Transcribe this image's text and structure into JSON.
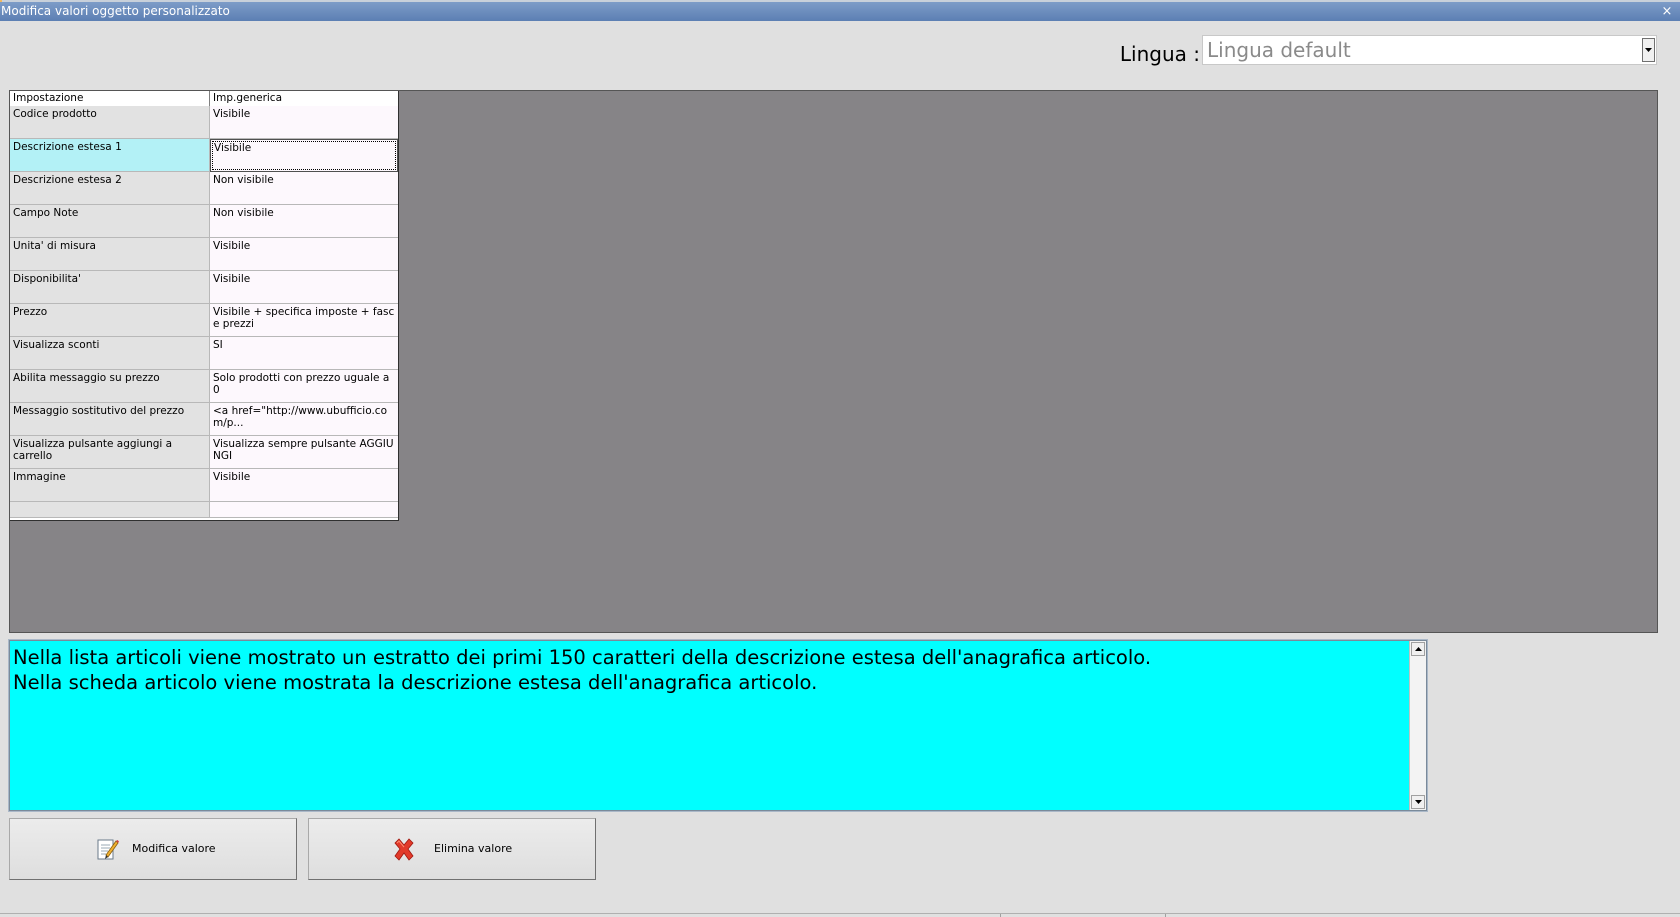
{
  "window": {
    "title": "Modifica valori oggetto personalizzato",
    "close_glyph": "×"
  },
  "language": {
    "label": "Lingua :",
    "selected": "Lingua default"
  },
  "grid": {
    "headers": [
      "Impostazione",
      "Imp.generica"
    ],
    "rows": [
      {
        "setting": "Codice prodotto",
        "value": "Visibile"
      },
      {
        "setting": "Descrizione estesa 1",
        "value": "Visibile"
      },
      {
        "setting": "Descrizione estesa 2",
        "value": "Non visibile"
      },
      {
        "setting": "Campo Note",
        "value": "Non visibile"
      },
      {
        "setting": "Unita' di misura",
        "value": "Visibile"
      },
      {
        "setting": "Disponibilita'",
        "value": "Visibile"
      },
      {
        "setting": "Prezzo",
        "value": "Visibile + specifica imposte + fasce prezzi"
      },
      {
        "setting": "Visualizza sconti",
        "value": "SI"
      },
      {
        "setting": "Abilita messaggio su prezzo",
        "value": "Solo prodotti con prezzo uguale a 0"
      },
      {
        "setting": "Messaggio sostitutivo del prezzo",
        "value": "<a href=\"http://www.ubufficio.com/p..."
      },
      {
        "setting": "Visualizza pulsante aggiungi a carrello",
        "value": "Visualizza sempre pulsante AGGIUNGI"
      },
      {
        "setting": "Immagine",
        "value": "Visibile"
      }
    ],
    "selected_row": "Descrizione estesa 1"
  },
  "description": {
    "text": "Nella lista articoli viene mostrato un estratto dei primi 150 caratteri della descrizione estesa dell'anagrafica articolo.\nNella scheda articolo viene mostrata la descrizione estesa dell'anagrafica articolo."
  },
  "buttons": {
    "edit_label": "Modifica valore",
    "delete_label": "Elimina valore"
  },
  "colors": {
    "description_bg": "#00ffff",
    "selected_row_bg": "#b3f1f6",
    "grid_area_bg": "#868487",
    "titlebar_bg": "#6a8cbd"
  },
  "icons": {
    "edit": "edit-note-icon",
    "delete": "red-x-icon"
  }
}
